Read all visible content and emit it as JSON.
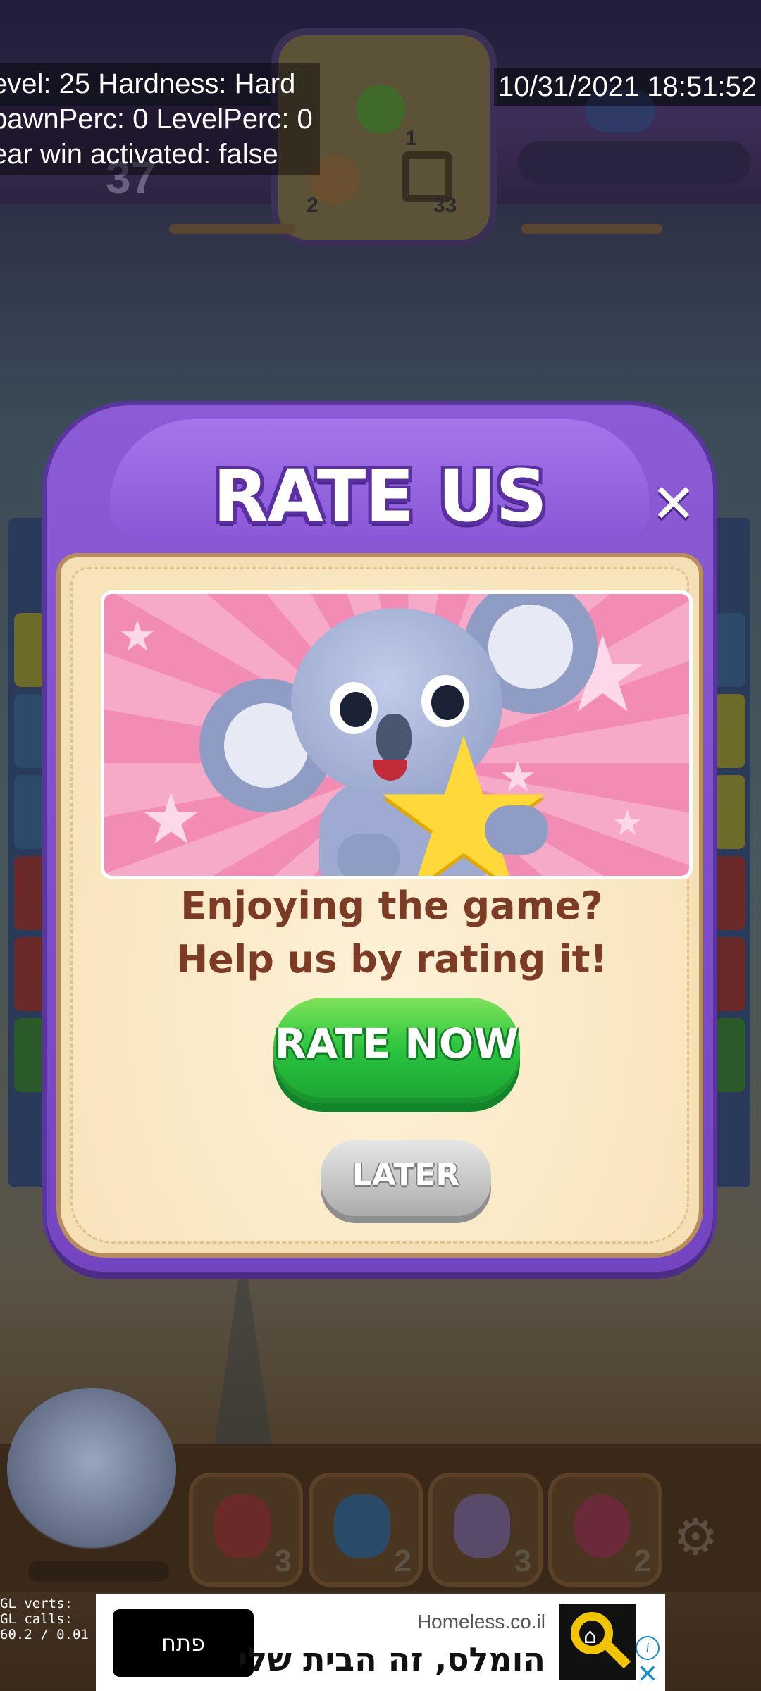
{
  "debug": {
    "line1": "evel: 25 Hardness: Hard",
    "line2": "pawnPerc: 0 LevelPerc: 0",
    "line3": "ear win activated: false",
    "datetime": "10/31/2021 18:51:52",
    "gl_line1": "GL verts:",
    "gl_line2": "GL calls:",
    "gl_line3": "60.2 / 0.01"
  },
  "game": {
    "moves_left": "37",
    "goals": [
      {
        "icon": "dino-icon",
        "count": "1"
      },
      {
        "icon": "hamster-icon",
        "count": "2"
      },
      {
        "icon": "crate-icon",
        "count": "33"
      }
    ],
    "boosters": [
      {
        "icon": "hammer-icon",
        "count": "3"
      },
      {
        "icon": "blaster-icon",
        "count": "2"
      },
      {
        "icon": "pinata-icon",
        "count": "3"
      },
      {
        "icon": "yoyo-icon",
        "count": "2"
      }
    ]
  },
  "dialog": {
    "title": "RATE US",
    "close_glyph": "✕",
    "question_line1": "Enjoying the game?",
    "question_line2": "Help us by rating it!",
    "rate_now_label": "RATE NOW",
    "later_label": "LATER"
  },
  "ad": {
    "open_label": "פתח",
    "advertiser": "Homeless.co.il",
    "headline": "הומלס, זה הבית שלי",
    "info_glyph": "i",
    "close_glyph": "✕"
  },
  "colors": {
    "dialog_purple": "#8c5bd6",
    "panel_cream": "#f5dfb5",
    "rate_now_green": "#29c33e",
    "later_grey": "#c3c3c3",
    "text_brown": "#7b3b24",
    "ad_logo_yellow": "#f2c400"
  }
}
